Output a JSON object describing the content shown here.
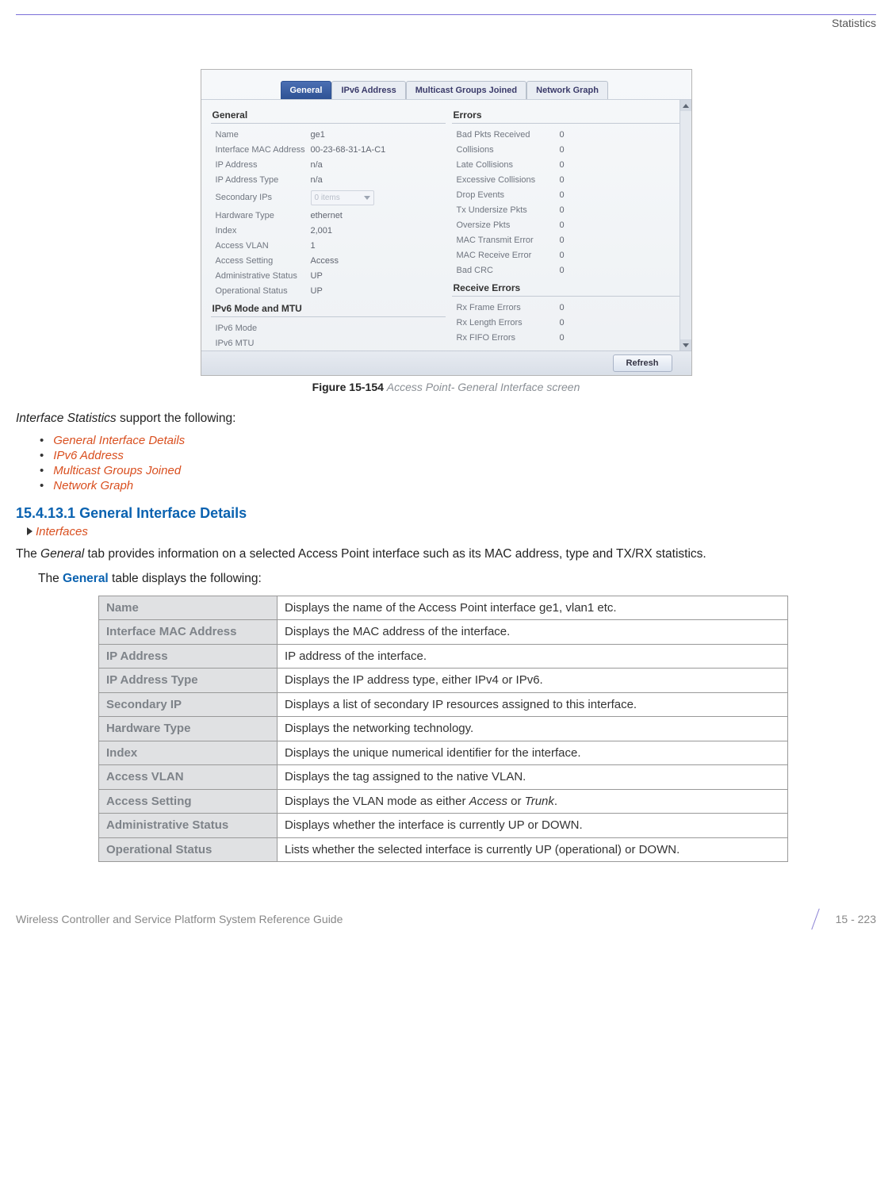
{
  "header": {
    "section": "Statistics"
  },
  "screenshot": {
    "tabs": [
      {
        "label": "General",
        "active": true
      },
      {
        "label": "IPv6 Address",
        "active": false
      },
      {
        "label": "Multicast Groups Joined",
        "active": false
      },
      {
        "label": "Network Graph",
        "active": false
      }
    ],
    "left": {
      "group1_title": "General",
      "rows1": [
        {
          "k": "Name",
          "v": "ge1"
        },
        {
          "k": "Interface MAC Address",
          "v": "00-23-68-31-1A-C1"
        },
        {
          "k": "IP Address",
          "v": "n/a"
        },
        {
          "k": "IP Address Type",
          "v": "n/a"
        },
        {
          "k": "Secondary IPs",
          "v": "__dropdown__"
        },
        {
          "k": "Hardware Type",
          "v": "ethernet"
        },
        {
          "k": "Index",
          "v": "2,001"
        },
        {
          "k": "Access VLAN",
          "v": "1"
        },
        {
          "k": "Access Setting",
          "v": "Access"
        },
        {
          "k": "Administrative Status",
          "v": "UP"
        },
        {
          "k": "Operational Status",
          "v": "UP"
        }
      ],
      "dropdown_placeholder": "0 items",
      "group2_title": "IPv6 Mode and MTU",
      "rows2": [
        {
          "k": "IPv6 Mode",
          "v": ""
        },
        {
          "k": "IPv6 MTU",
          "v": ""
        }
      ]
    },
    "right": {
      "group1_title": "Errors",
      "rows1": [
        {
          "k": "Bad Pkts Received",
          "v": "0"
        },
        {
          "k": "Collisions",
          "v": "0"
        },
        {
          "k": "Late Collisions",
          "v": "0"
        },
        {
          "k": "Excessive Collisions",
          "v": "0"
        },
        {
          "k": "Drop Events",
          "v": "0"
        },
        {
          "k": "Tx Undersize Pkts",
          "v": "0"
        },
        {
          "k": "Oversize Pkts",
          "v": "0"
        },
        {
          "k": "MAC Transmit Error",
          "v": "0"
        },
        {
          "k": "MAC Receive Error",
          "v": "0"
        },
        {
          "k": "Bad CRC",
          "v": "0"
        }
      ],
      "group2_title": "Receive Errors",
      "rows2": [
        {
          "k": "Rx Frame Errors",
          "v": "0"
        },
        {
          "k": "Rx Length Errors",
          "v": "0"
        },
        {
          "k": "Rx FIFO Errors",
          "v": "0"
        }
      ]
    },
    "refresh": "Refresh"
  },
  "figure": {
    "num": "Figure 15-154",
    "desc": "Access Point- General Interface screen"
  },
  "intro": {
    "lead_italic": "Interface Statistics",
    "lead_rest": " support the following:",
    "bullets": [
      "General Interface Details",
      "IPv6 Address",
      "Multicast Groups Joined",
      "Network Graph"
    ]
  },
  "section": {
    "heading": "15.4.13.1  General Interface Details",
    "breadcrumb": "Interfaces",
    "p1_prefix": "The ",
    "p1_italic": "General",
    "p1_rest": " tab provides information on a selected Access Point interface such as its MAC address, type and TX/RX statistics.",
    "p2_prefix": "The ",
    "p2_bold": "General",
    "p2_rest": " table displays the following:"
  },
  "table": [
    {
      "label": "Name",
      "desc": "Displays the name of the Access Point interface ge1, vlan1 etc."
    },
    {
      "label": "Interface MAC Address",
      "desc": "Displays the MAC address of the interface."
    },
    {
      "label": "IP Address",
      "desc": "IP address of the interface."
    },
    {
      "label": "IP Address Type",
      "desc": "Displays the IP address type, either IPv4 or IPv6."
    },
    {
      "label": "Secondary IP",
      "desc": "Displays a list of secondary IP resources assigned to this interface."
    },
    {
      "label": "Hardware Type",
      "desc": "Displays the networking technology."
    },
    {
      "label": "Index",
      "desc": "Displays the unique numerical identifier for the interface."
    },
    {
      "label": "Access VLAN",
      "desc": "Displays the tag assigned to the native VLAN."
    },
    {
      "label": "Access Setting",
      "desc_pre": "Displays the VLAN mode as either ",
      "i1": "Access",
      "mid": " or ",
      "i2": "Trunk",
      "post": "."
    },
    {
      "label": "Administrative Status",
      "desc": "Displays whether the interface is currently UP or DOWN."
    },
    {
      "label": "Operational Status",
      "desc": "Lists whether the selected interface is currently UP (operational) or DOWN."
    }
  ],
  "footer": {
    "left": "Wireless Controller and Service Platform System Reference Guide",
    "right": "15 - 223"
  }
}
